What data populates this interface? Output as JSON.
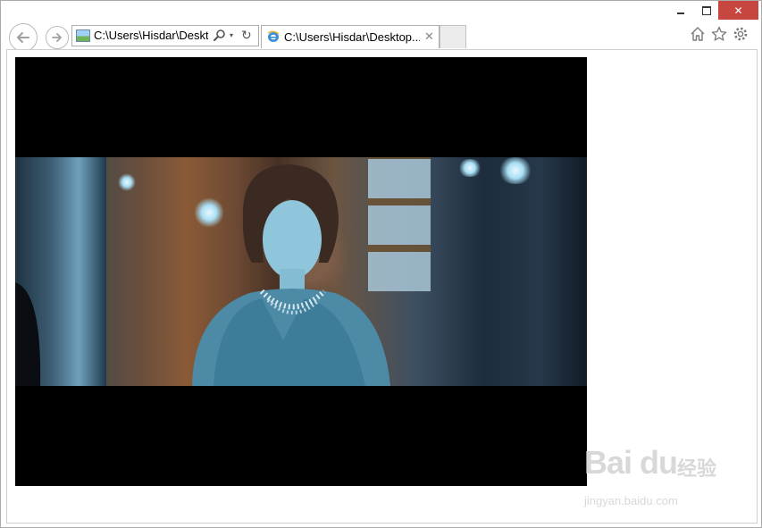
{
  "titlebar": {
    "minimize_icon": "minimize-icon",
    "maximize_icon": "maximize-icon",
    "close_glyph": "✕"
  },
  "nav": {
    "back_icon": "back-arrow-icon",
    "forward_icon": "forward-arrow-icon",
    "address_text": "C:\\Users\\Hisdar\\Deskt",
    "search_icon": "search-icon",
    "dropdown_glyph": "▾",
    "refresh_glyph": "↻"
  },
  "tab": {
    "title": "C:\\Users\\Hisdar\\Desktop...",
    "close_glyph": "✕"
  },
  "toolbar": {
    "home_icon": "home-icon",
    "favorites_icon": "star-icon",
    "settings_icon": "gear-icon"
  },
  "watermark": {
    "brand": "Bai du",
    "brand_cn": "经验",
    "url": "jingyan.baidu.com"
  },
  "colors": {
    "close_button": "#c7463f",
    "player_background": "#000000",
    "window_border": "#a9a9a9"
  }
}
